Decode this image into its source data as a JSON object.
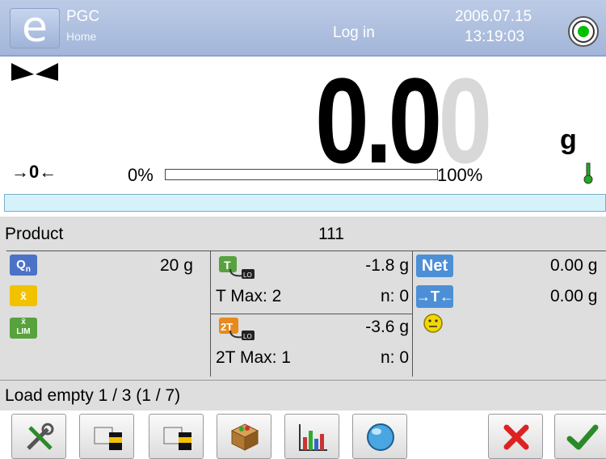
{
  "header": {
    "app_title": "PGC",
    "app_subtitle": "Home",
    "login": "Log in",
    "date": "2006.07.15",
    "time": "13:19:03"
  },
  "display": {
    "reading_main": "0.0",
    "reading_last": "0",
    "unit": "g",
    "zero_indicator": "→0←",
    "range_min": "0%",
    "range_max": "100%",
    "range_fill_fraction": 0
  },
  "product": {
    "label": "Product",
    "value": "111"
  },
  "stats": {
    "qn_label": "Qn",
    "qn_value": "20 g",
    "xbar_label": "x̄",
    "xlim_label": "x̄ LIM",
    "tare_value": "-1.8 g",
    "tare_max": "T Max: 2",
    "tare_n": "n: 0",
    "tare2_value": "-3.6 g",
    "tare2_max": "2T Max: 1",
    "tare2_n": "n: 0",
    "net_label": "Net",
    "net_value": "0.00 g",
    "tare_badge": "→T←",
    "tare_total": "0.00 g"
  },
  "status": {
    "load": "Load empty 1 / 3 (1 / 7)"
  },
  "toolbar": {
    "buttons": [
      "settings-icon",
      "print-icon",
      "print-icon",
      "product-database-icon",
      "statistics-icon",
      "info-icon",
      "cancel-icon",
      "confirm-icon"
    ]
  },
  "colors": {
    "header_bg": "#a3b6d9",
    "info_strip": "#d5f2fb",
    "gray_panel": "#dedede",
    "status_green": "#00c000",
    "cancel_red": "#d22",
    "confirm_green": "#2a8a2a"
  }
}
